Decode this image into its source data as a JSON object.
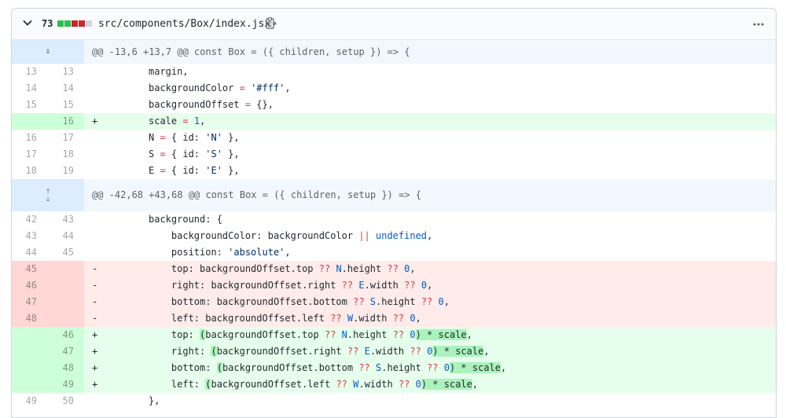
{
  "file_header": {
    "changes_count": "73",
    "diffstat_colors": [
      "#2cbe4e",
      "#2cbe4e",
      "#cb2431",
      "#cb2431",
      "#d1d5da"
    ],
    "filename": "src/components/Box/index.jsx",
    "icons": [
      "chevron-down-icon",
      "clipboard-icon",
      "kebab-horizontal-icon"
    ]
  },
  "hunks": [
    {
      "header": "@@ -13,6 +13,7 @@ const Box = ({ children, setup }) => {"
    },
    {
      "header": "@@ -42,68 +43,68 @@ const Box = ({ children, setup }) => {"
    }
  ],
  "lines": [
    {
      "old": "13",
      "new": "13",
      "sign": "",
      "code": "        margin,"
    },
    {
      "old": "14",
      "new": "14",
      "sign": "",
      "code": "        backgroundColor = '#fff',"
    },
    {
      "old": "15",
      "new": "15",
      "sign": "",
      "code": "        backgroundOffset = {},"
    },
    {
      "old": "",
      "new": "16",
      "sign": "+",
      "code": "        scale = 1,"
    },
    {
      "old": "16",
      "new": "17",
      "sign": "",
      "code": "        N = { id: 'N' },"
    },
    {
      "old": "17",
      "new": "18",
      "sign": "",
      "code": "        S = { id: 'S' },"
    },
    {
      "old": "18",
      "new": "19",
      "sign": "",
      "code": "        E = { id: 'E' },"
    },
    {
      "old": "42",
      "new": "43",
      "sign": "",
      "code": "        background: {"
    },
    {
      "old": "43",
      "new": "44",
      "sign": "",
      "code": "            backgroundColor: backgroundColor || undefined,"
    },
    {
      "old": "44",
      "new": "45",
      "sign": "",
      "code": "            position: 'absolute',"
    },
    {
      "old": "45",
      "new": "",
      "sign": "-",
      "code": "            top: backgroundOffset.top ?? N.height ?? 0,"
    },
    {
      "old": "46",
      "new": "",
      "sign": "-",
      "code": "            right: backgroundOffset.right ?? E.width ?? 0,"
    },
    {
      "old": "47",
      "new": "",
      "sign": "-",
      "code": "            bottom: backgroundOffset.bottom ?? S.height ?? 0,"
    },
    {
      "old": "48",
      "new": "",
      "sign": "-",
      "code": "            left: backgroundOffset.left ?? W.width ?? 0,"
    },
    {
      "old": "",
      "new": "46",
      "sign": "+",
      "code": "            top: (backgroundOffset.top ?? N.height ?? 0) * scale,"
    },
    {
      "old": "",
      "new": "47",
      "sign": "+",
      "code": "            right: (backgroundOffset.right ?? E.width ?? 0) * scale,"
    },
    {
      "old": "",
      "new": "48",
      "sign": "+",
      "code": "            bottom: (backgroundOffset.bottom ?? S.height ?? 0) * scale,"
    },
    {
      "old": "",
      "new": "49",
      "sign": "+",
      "code": "            left: (backgroundOffset.left ?? W.width ?? 0) * scale,"
    },
    {
      "old": "49",
      "new": "50",
      "sign": "",
      "code": "        },"
    }
  ]
}
